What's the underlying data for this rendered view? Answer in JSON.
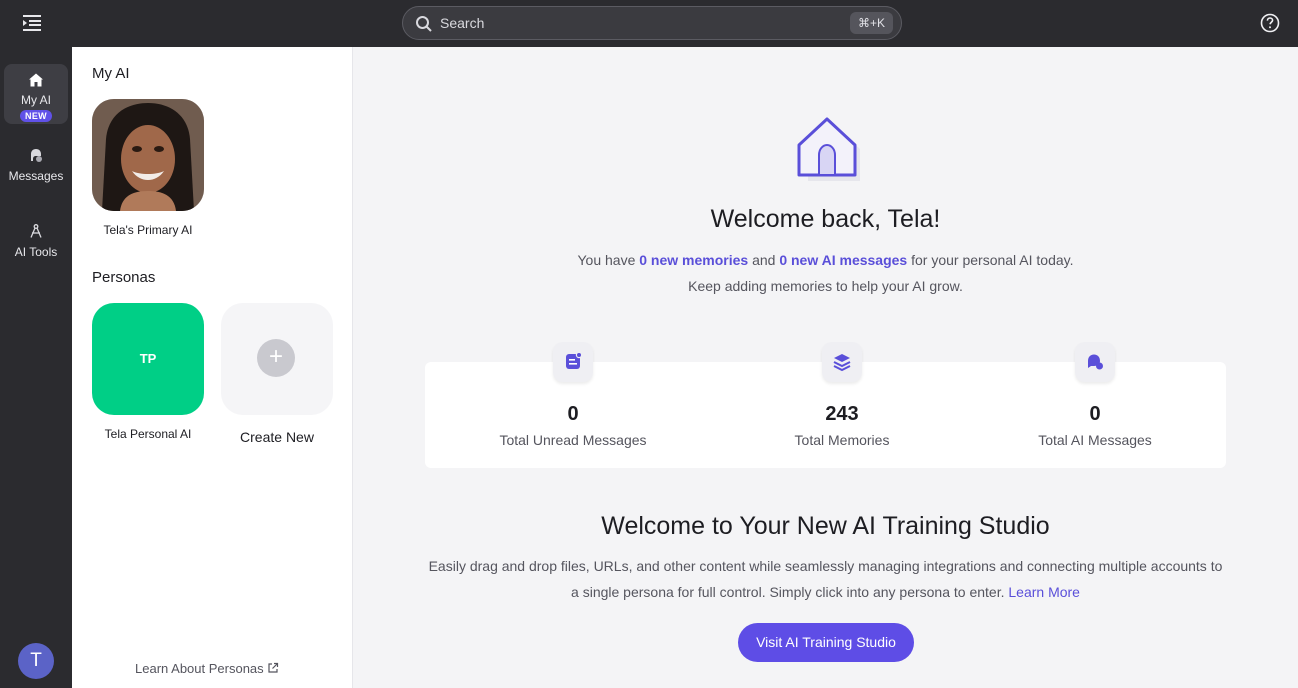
{
  "header": {
    "search_placeholder": "Search",
    "search_shortcut": "⌘+K"
  },
  "rail": {
    "items": [
      {
        "label": "My AI",
        "badge": "NEW",
        "icon": "home-icon"
      },
      {
        "label": "Messages",
        "icon": "chat-bubbles-icon"
      },
      {
        "label": "AI Tools",
        "icon": "ai-tools-icon"
      }
    ],
    "avatar_initial": "T"
  },
  "panel": {
    "my_ai_heading": "My AI",
    "primary_ai_label": "Tela's Primary AI",
    "personas_heading": "Personas",
    "persona_initials": "TP",
    "persona_label": "Tela Personal AI",
    "create_new_label": "Create New",
    "learn_link": "Learn About Personas"
  },
  "main": {
    "welcome_title": "Welcome back, Tela!",
    "line1_prefix": "You have ",
    "line1_memories": "0 new memories",
    "line1_and": " and ",
    "line1_messages": "0 new AI messages",
    "line1_suffix": " for your personal AI today.",
    "line2": "Keep adding memories to help your AI grow.",
    "stats": [
      {
        "value": "0",
        "label": "Total Unread Messages",
        "icon": "note-icon"
      },
      {
        "value": "243",
        "label": "Total Memories",
        "icon": "layers-icon"
      },
      {
        "value": "0",
        "label": "Total AI Messages",
        "icon": "chat-icon"
      }
    ],
    "studio_title": "Welcome to Your New AI Training Studio",
    "studio_desc": "Easily drag and drop files, URLs, and other content while seamlessly managing integrations and connecting multiple accounts to a single persona for full control. Simply click into any persona to enter.",
    "studio_link": "Learn More",
    "cta_label": "Visit AI Training Studio"
  },
  "colors": {
    "accent": "#5e4de6",
    "persona_tile": "#00cf86",
    "rail_bg": "#2b2b2f"
  }
}
